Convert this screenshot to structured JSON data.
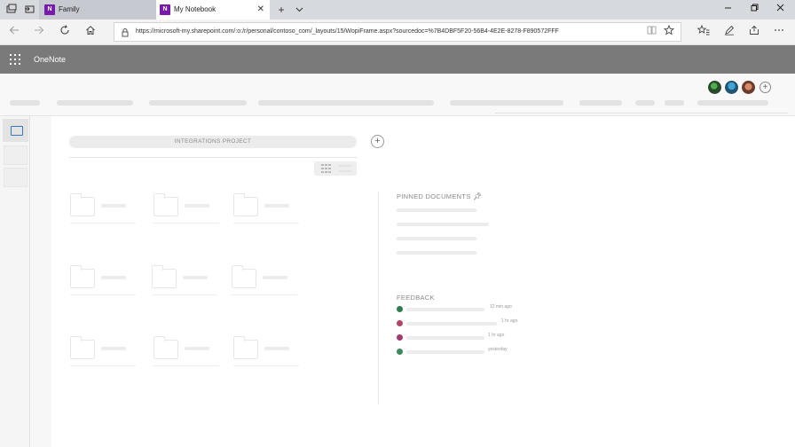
{
  "browser": {
    "tabs": [
      {
        "title": "Family",
        "active": false,
        "icon": "onenote-icon"
      },
      {
        "title": "My Notebook",
        "active": true,
        "icon": "onenote-icon"
      }
    ],
    "tab_icon_letter": "N",
    "url": "https://microsoft-my.sharepoint.com/:o:/r/personal/contoso_com/_layouts/15/WopiFrame.aspx?sourcedoc=%7B4DBF5F20-56B4-4E2E-8278-F890572FFF",
    "window_controls": [
      "minimize",
      "restore",
      "close"
    ]
  },
  "app": {
    "name": "OneNote"
  },
  "workspace": {
    "project_title": "INTEGRATIONS PROJECT",
    "pinned_title": "PINNED DOCUMENTS",
    "feedback_title": "FEEDBACK",
    "feedback": [
      {
        "time": "12 min ago",
        "color": "#2e7d4f"
      },
      {
        "time": "1 hr ago",
        "color": "#b0456b"
      },
      {
        "time": "1 hr ago",
        "color": "#9c3d6e"
      },
      {
        "time": "yesterday",
        "color": "#3a8a5c"
      }
    ]
  },
  "colors": {
    "appbar": "#7a7a7a",
    "onenote": "#7719aa",
    "tabbar": "#d6d9de"
  }
}
